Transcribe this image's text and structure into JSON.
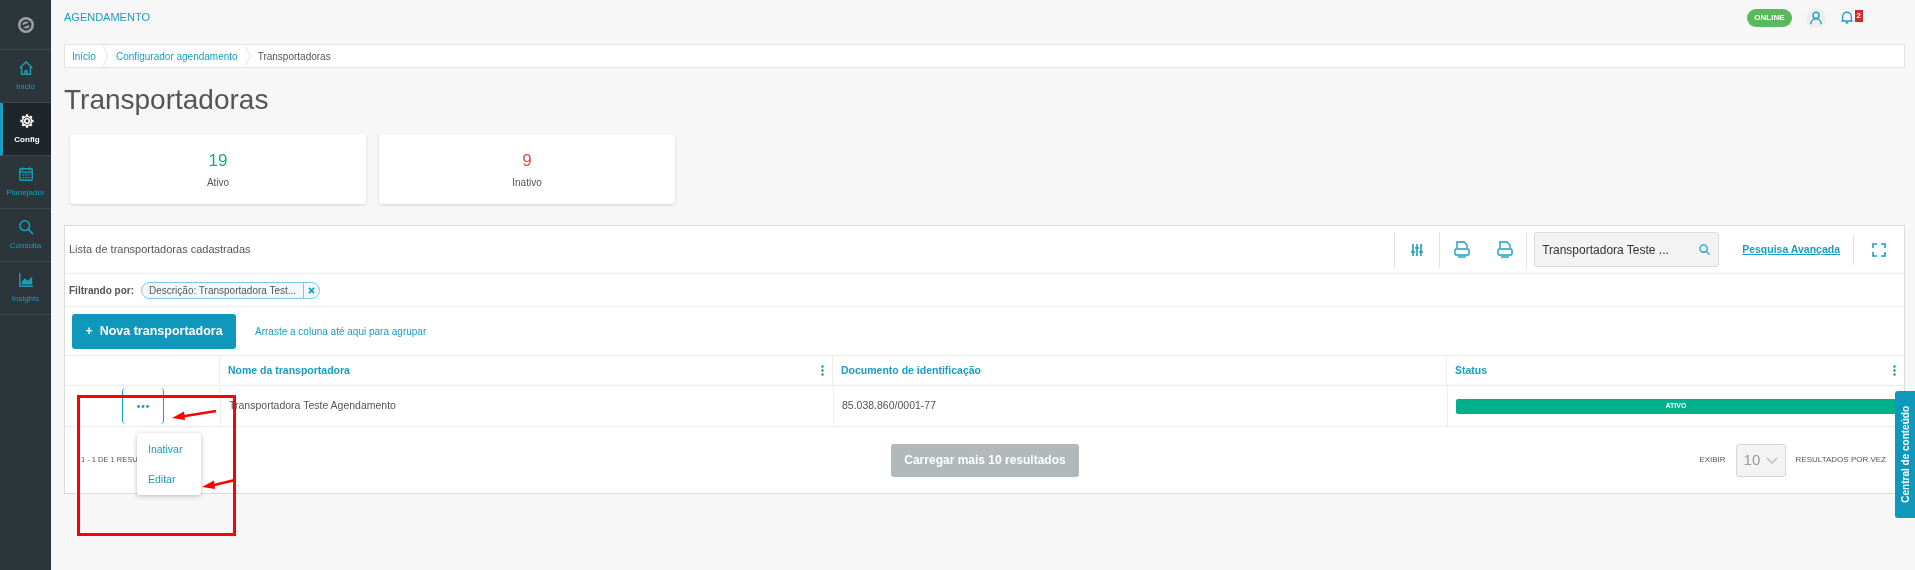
{
  "header": {
    "title": "AGENDAMENTO",
    "status": "ONLINE",
    "notifications": "2"
  },
  "sidebar": [
    {
      "label": "Início",
      "selected": false
    },
    {
      "label": "Config",
      "selected": true
    },
    {
      "label": "Planejador",
      "selected": false
    },
    {
      "label": "Consulta",
      "selected": false
    },
    {
      "label": "Insights",
      "selected": false
    }
  ],
  "breadcrumb": [
    "Início",
    "Configurador agendamento",
    "Transportadoras"
  ],
  "page_title": "Transportadoras",
  "summary_cards": [
    {
      "value": "19",
      "label": "Ativo",
      "color": "#1aaa8a"
    },
    {
      "value": "9",
      "label": "Inativo",
      "color": "#d9534f"
    }
  ],
  "panel": {
    "title": "Lista de transportadoras cadastradas",
    "search": {
      "value": "Transportadora Teste ..."
    },
    "advanced_search": "Pesquisa Avançada",
    "filter_label": "Filtrando por:",
    "filter_chip": "Descrição: Transportadora Test...",
    "new_button": "Nova transportadora",
    "new_button_prefix": "+",
    "group_hint": "Arraste a coluna até aqui para agrupar"
  },
  "table": {
    "columns": [
      {
        "label": "Nome da transportadora",
        "menu": true
      },
      {
        "label": "Documento de identificação",
        "menu": false
      },
      {
        "label": "Status",
        "menu": true
      }
    ],
    "rows": [
      {
        "name": "Transportadora Teste Agendamento",
        "document": "85.038.860/0001-77",
        "status": "ATIVO"
      }
    ]
  },
  "row_menu": {
    "items": [
      "Inativar",
      "Editar"
    ]
  },
  "footer": {
    "range": "1 - 1 DE 1 RESU",
    "load_more": "Carregar mais 10 resultados",
    "load_more_disabled": true,
    "show": "EXIBIR",
    "page_size": "10",
    "per_page": "RESULTADOS POR VEZ"
  },
  "side_tab": "Central de conteúdo"
}
